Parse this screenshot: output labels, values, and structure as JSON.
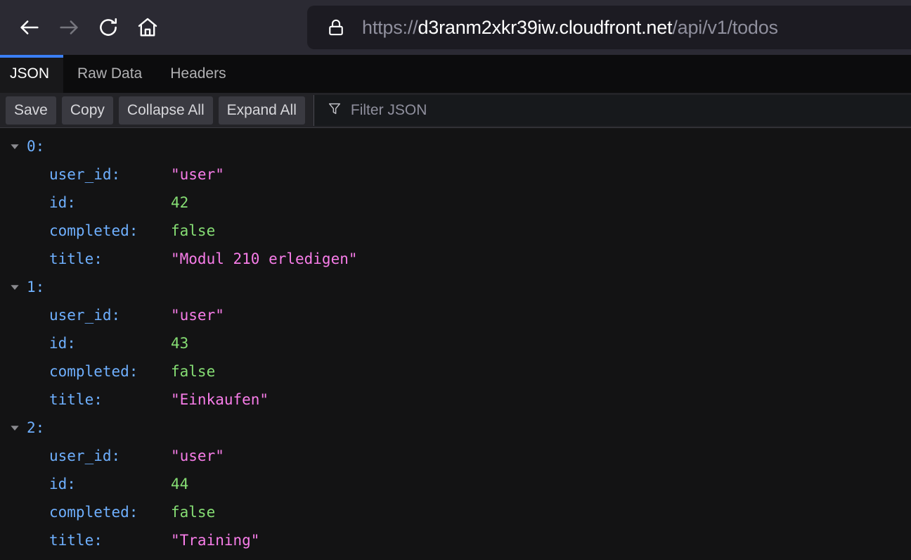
{
  "browser": {
    "nav": {
      "back_label": "Back",
      "forward_label": "Forward",
      "reload_label": "Reload",
      "home_label": "Home"
    },
    "urlbar": {
      "lock_label": "Connection secure",
      "url_prefix": "https://",
      "url_host": "d3ranm2xkr39iw.cloudfront.net",
      "url_path": "/api/v1/todos",
      "full_url": "https://d3ranm2xkr39iw.cloudfront.net/api/v1/todos"
    }
  },
  "viewer": {
    "tabs": [
      {
        "label": "JSON",
        "active": true
      },
      {
        "label": "Raw Data",
        "active": false
      },
      {
        "label": "Headers",
        "active": false
      }
    ],
    "toolbar": {
      "save_label": "Save",
      "copy_label": "Copy",
      "collapse_all_label": "Collapse All",
      "expand_all_label": "Expand All",
      "filter_placeholder": "Filter JSON",
      "filter_value": ""
    }
  },
  "json": {
    "nodes": [
      {
        "index": "0:",
        "props": [
          {
            "key": "user_id:",
            "value": "\"user\"",
            "type": "string"
          },
          {
            "key": "id:",
            "value": "42",
            "type": "number"
          },
          {
            "key": "completed:",
            "value": "false",
            "type": "boolean"
          },
          {
            "key": "title:",
            "value": "\"Modul 210 erledigen\"",
            "type": "string"
          }
        ]
      },
      {
        "index": "1:",
        "props": [
          {
            "key": "user_id:",
            "value": "\"user\"",
            "type": "string"
          },
          {
            "key": "id:",
            "value": "43",
            "type": "number"
          },
          {
            "key": "completed:",
            "value": "false",
            "type": "boolean"
          },
          {
            "key": "title:",
            "value": "\"Einkaufen\"",
            "type": "string"
          }
        ]
      },
      {
        "index": "2:",
        "props": [
          {
            "key": "user_id:",
            "value": "\"user\"",
            "type": "string"
          },
          {
            "key": "id:",
            "value": "44",
            "type": "number"
          },
          {
            "key": "completed:",
            "value": "false",
            "type": "boolean"
          },
          {
            "key": "title:",
            "value": "\"Training\"",
            "type": "string"
          }
        ]
      }
    ]
  },
  "colors": {
    "chrome_bg": "#2b2a33",
    "urlbar_bg": "#1c1b22",
    "tabbar_bg": "#0c0c0d",
    "toolbar_bg": "#232327",
    "content_bg": "#131314",
    "accent_blue": "#3b7ff5",
    "key_blue": "#6fb0ff",
    "string_pink": "#f87de9",
    "number_green": "#86de74"
  }
}
